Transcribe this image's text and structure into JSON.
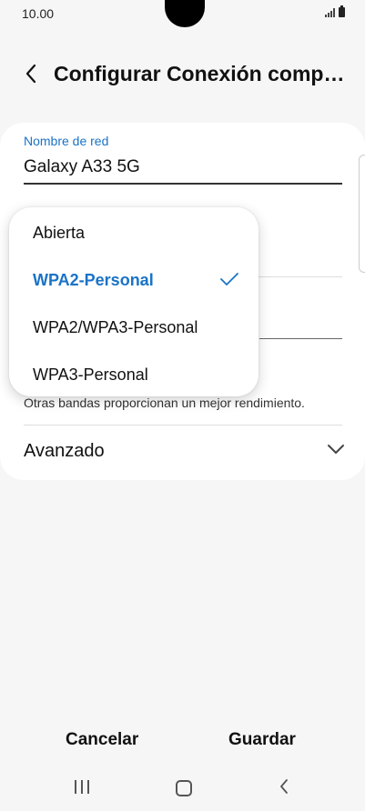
{
  "status_bar": {
    "time": "10.00"
  },
  "header": {
    "title": "Configurar Conexión compa…"
  },
  "network": {
    "label": "Nombre de red",
    "value": "Galaxy A33 5G"
  },
  "band_note": "Otras bandas proporcionan un mejor rendimiento.",
  "advanced": {
    "label": "Avanzado"
  },
  "security_dropdown": {
    "options": [
      {
        "label": "Abierta",
        "selected": false
      },
      {
        "label": "WPA2-Personal",
        "selected": true
      },
      {
        "label": "WPA2/WPA3-Personal",
        "selected": false
      },
      {
        "label": "WPA3-Personal",
        "selected": false
      }
    ]
  },
  "footer": {
    "cancel": "Cancelar",
    "save": "Guardar"
  },
  "colors": {
    "accent": "#1a73c7",
    "background": "#f6f6f6",
    "card": "#ffffff"
  },
  "icons": [
    "back-arrow-icon",
    "check-icon",
    "chevron-down-icon",
    "signal-icon",
    "battery-icon",
    "nav-recents-icon",
    "nav-home-icon",
    "nav-back-icon"
  ]
}
